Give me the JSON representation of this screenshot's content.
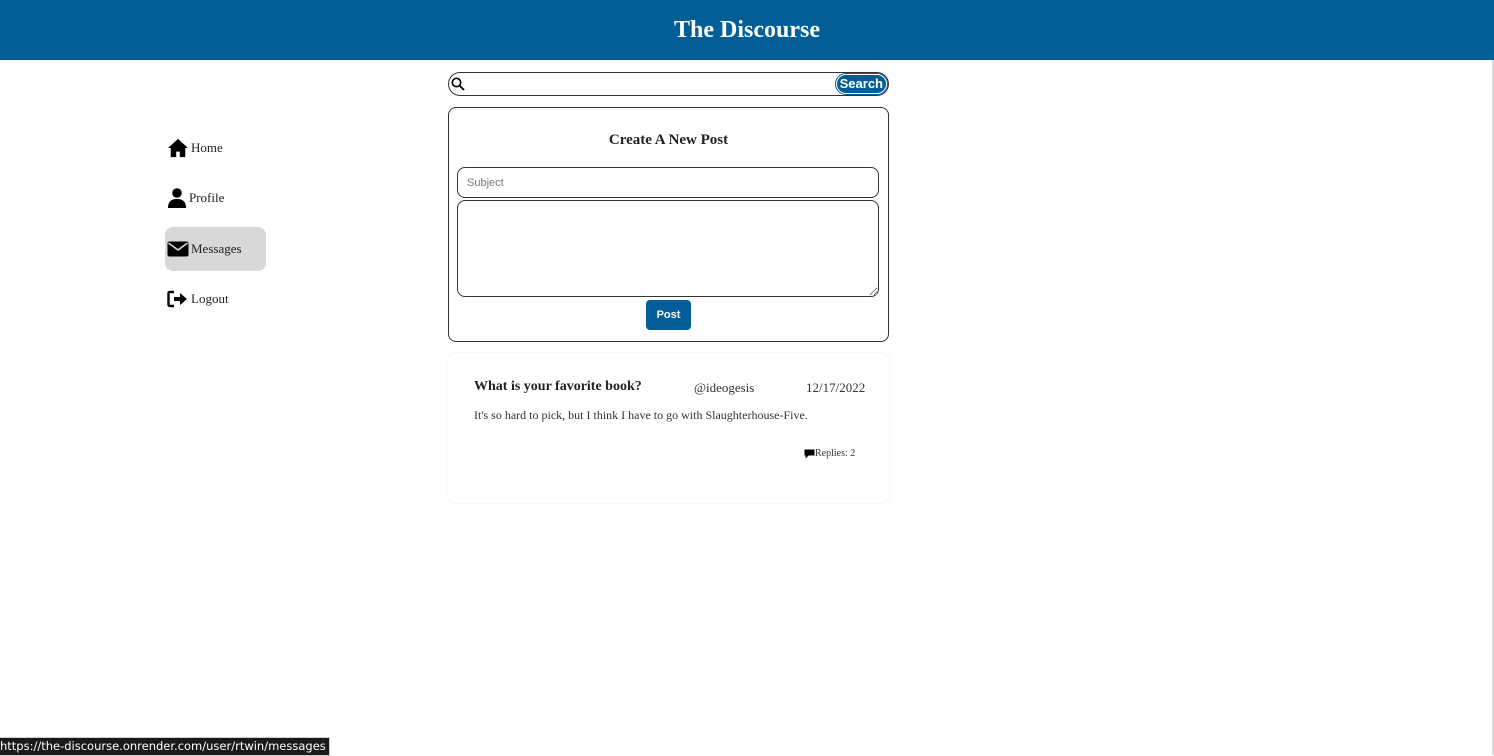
{
  "header": {
    "title": "The Discourse",
    "background": "#035e97"
  },
  "sidebar": {
    "items": [
      {
        "label": "Home",
        "icon": "home-icon"
      },
      {
        "label": "Profile",
        "icon": "user-icon"
      },
      {
        "label": "Messages",
        "icon": "envelope-icon",
        "active": true
      },
      {
        "label": "Logout",
        "icon": "logout-icon"
      }
    ]
  },
  "search": {
    "value": "",
    "placeholder": "",
    "button_label": "Search"
  },
  "create_post": {
    "title": "Create A New Post",
    "subject_placeholder": "Subject",
    "body_value": "",
    "post_button_label": "Post"
  },
  "posts": [
    {
      "title": "What is your favorite book?",
      "author": "@ideogesis",
      "date": "12/17/2022",
      "body": "It's so hard to pick, but I think I have to go with Slaughterhouse-Five.",
      "replies_label": "Replies: 2",
      "reply_icon": "comment-icon"
    }
  ],
  "status_bar": {
    "url": "https://the-discourse.onrender.com/user/rtwin/messages"
  },
  "colors": {
    "accent": "#035e97",
    "active_nav": "#d8d8d8"
  }
}
